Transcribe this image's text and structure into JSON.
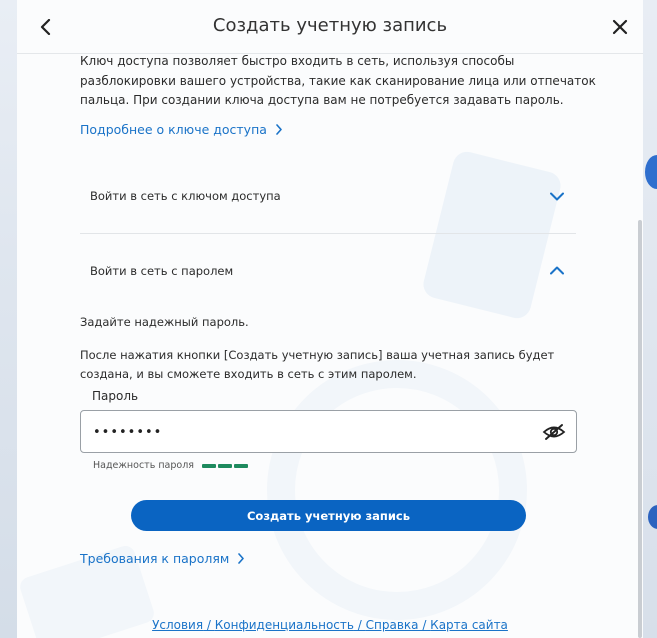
{
  "dialog": {
    "title": "Создать учетную запись"
  },
  "intro": {
    "text": "Ключ доступа позволяет быстро входить в сеть, используя способы разблокировки вашего устройства, такие как сканирование лица или отпечаток пальца. При создании ключа доступа вам не потребуется задавать пароль."
  },
  "links": {
    "more_about_key": "Подробнее о ключе доступа",
    "password_requirements": "Требования к паролям"
  },
  "accordions": [
    {
      "label": "Войти в сеть с ключом доступа",
      "expanded": false
    },
    {
      "label": "Войти в сеть с паролем",
      "expanded": true
    }
  ],
  "password_section": {
    "hint": "Задайте надежный пароль.",
    "description": "После нажатия кнопки [Создать учетную запись] ваша учетная запись будет создана, и вы сможете входить в сеть с этим паролем.",
    "field_label": "Пароль",
    "field_value": "••••••••",
    "strength_label": "Надежность пароля",
    "strength_level": 3
  },
  "buttons": {
    "create_account": "Создать учетную запись"
  },
  "footer": {
    "terms": "Условия",
    "privacy": "Конфиденциальность",
    "help": "Справка",
    "sitemap": "Карта сайта",
    "separator": " / "
  },
  "colors": {
    "accent": "#0a64c2",
    "link": "#1a73c8",
    "strength": "#1e8a5e"
  },
  "icons": [
    "back-arrow-icon",
    "close-icon",
    "chevron-right-icon",
    "chevron-down-icon",
    "chevron-up-icon",
    "eye-slash-icon"
  ]
}
